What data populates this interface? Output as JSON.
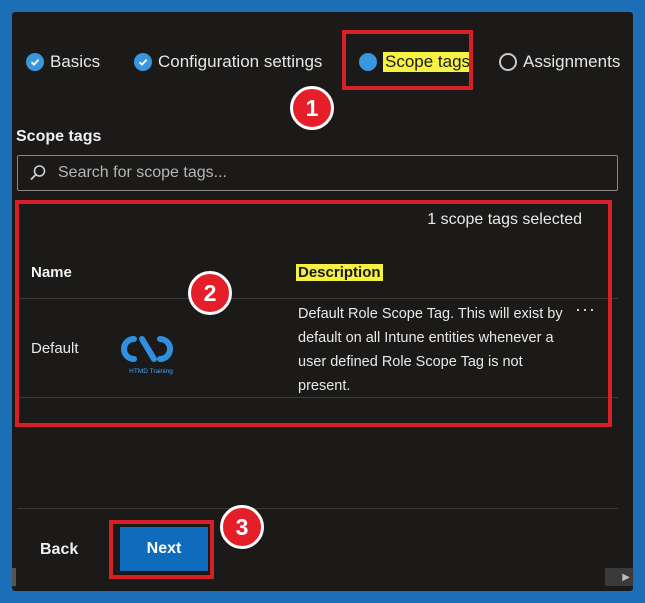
{
  "tabs": [
    {
      "label": "Basics",
      "state": "done"
    },
    {
      "label": "Configuration settings",
      "state": "done"
    },
    {
      "label": "Scope tags",
      "state": "current"
    },
    {
      "label": "Assignments",
      "state": "pending"
    }
  ],
  "section_title": "Scope tags",
  "search": {
    "placeholder": "Search for scope tags..."
  },
  "selected_count": "1 scope tags selected",
  "table": {
    "headers": {
      "name": "Name",
      "description": "Description"
    },
    "rows": [
      {
        "name": "Default",
        "description": "Default Role Scope Tag. This will exist by default on all Intune entities whenever a user defined Role Scope Tag is not present.",
        "more": "···"
      }
    ]
  },
  "logo_text": "HTMD Training",
  "footer": {
    "back": "Back",
    "next": "Next"
  },
  "badges": [
    "1",
    "2",
    "3"
  ],
  "colors": {
    "highlight_box": "#d71f27",
    "badge": "#e51f2a",
    "text_highlight": "#f5f242",
    "primary": "#0f6cbd",
    "accent": "#3a96dd"
  }
}
